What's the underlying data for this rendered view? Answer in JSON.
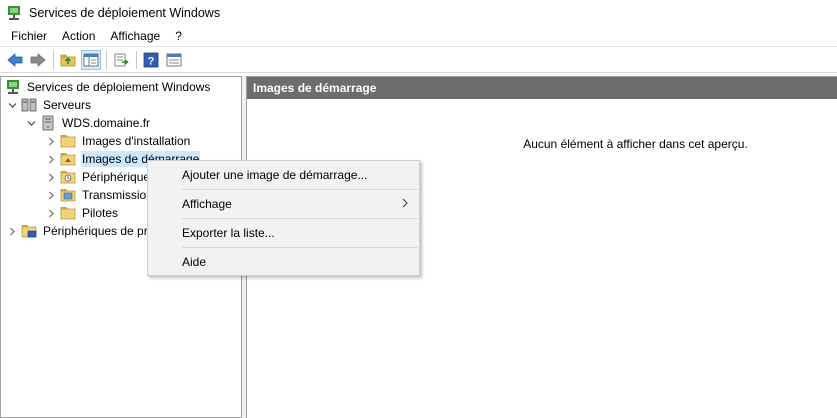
{
  "window": {
    "title": "Services de déploiement Windows"
  },
  "menubar": {
    "items": [
      "Fichier",
      "Action",
      "Affichage",
      "?"
    ]
  },
  "toolbar": {
    "buttons": [
      "back-icon",
      "forward-icon",
      "up-folder-icon",
      "show-hide-tree-icon",
      "export-list-icon",
      "help-icon",
      "properties-icon"
    ]
  },
  "tree": {
    "root": "Services de déploiement Windows",
    "servers": "Serveurs",
    "server_name": "WDS.domaine.fr",
    "install_images": "Images d'installation",
    "boot_images": "Images de démarrage",
    "pending_devices": "Périphériques",
    "multicast": "Transmissio",
    "drivers": "Pilotes",
    "active_directory_devices": "Périphériques de pr"
  },
  "right_pane": {
    "header": "Images de démarrage",
    "empty_message": "Aucun élément à afficher dans cet aperçu."
  },
  "context_menu": {
    "add_boot_image": "Ajouter une image de démarrage...",
    "view": "Affichage",
    "export_list": "Exporter la liste...",
    "help": "Aide"
  },
  "colors": {
    "header_bg": "#6d6d6d",
    "selection": "#cce8ff",
    "menu_bg": "#f2f2f2"
  }
}
